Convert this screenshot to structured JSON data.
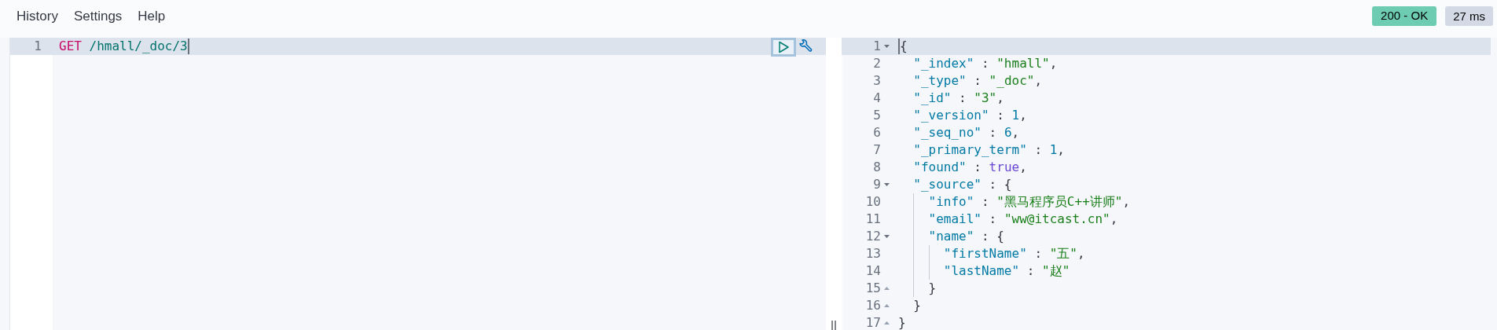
{
  "menu": [
    {
      "label": "History"
    },
    {
      "label": "Settings"
    },
    {
      "label": "Help"
    }
  ],
  "status": {
    "code": "200 - OK",
    "time": "27 ms"
  },
  "request": {
    "lines": [
      {
        "number": "1",
        "active": true,
        "tokens": [
          {
            "kind": "method",
            "text": "GET"
          },
          {
            "kind": "path",
            "text": "/hmall/_doc/3"
          },
          {
            "kind": "cursor"
          }
        ]
      }
    ]
  },
  "response": {
    "lines": [
      {
        "number": "1",
        "active": true,
        "kind": "open",
        "tokens": [
          {
            "kind": "cursor"
          },
          {
            "kind": "punct",
            "text": "{"
          }
        ]
      },
      {
        "number": "2",
        "active": false,
        "kind": "plain",
        "tokens": [
          {
            "kind": "key",
            "text": "  \"_index\""
          },
          {
            "kind": "punct",
            "text": " : "
          },
          {
            "kind": "string",
            "text": "\"hmall\""
          },
          {
            "kind": "punct",
            "text": ","
          }
        ]
      },
      {
        "number": "3",
        "active": false,
        "kind": "plain",
        "tokens": [
          {
            "kind": "key",
            "text": "  \"_type\""
          },
          {
            "kind": "punct",
            "text": " : "
          },
          {
            "kind": "string",
            "text": "\"_doc\""
          },
          {
            "kind": "punct",
            "text": ","
          }
        ]
      },
      {
        "number": "4",
        "active": false,
        "kind": "plain",
        "tokens": [
          {
            "kind": "key",
            "text": "  \"_id\""
          },
          {
            "kind": "punct",
            "text": " : "
          },
          {
            "kind": "string",
            "text": "\"3\""
          },
          {
            "kind": "punct",
            "text": ","
          }
        ]
      },
      {
        "number": "5",
        "active": false,
        "kind": "plain",
        "tokens": [
          {
            "kind": "key",
            "text": "  \"_version\""
          },
          {
            "kind": "punct",
            "text": " : "
          },
          {
            "kind": "number",
            "text": "1"
          },
          {
            "kind": "punct",
            "text": ","
          }
        ]
      },
      {
        "number": "6",
        "active": false,
        "kind": "plain",
        "tokens": [
          {
            "kind": "key",
            "text": "  \"_seq_no\""
          },
          {
            "kind": "punct",
            "text": " : "
          },
          {
            "kind": "number",
            "text": "6"
          },
          {
            "kind": "punct",
            "text": ","
          }
        ]
      },
      {
        "number": "7",
        "active": false,
        "kind": "plain",
        "tokens": [
          {
            "kind": "key",
            "text": "  \"_primary_term\""
          },
          {
            "kind": "punct",
            "text": " : "
          },
          {
            "kind": "number",
            "text": "1"
          },
          {
            "kind": "punct",
            "text": ","
          }
        ]
      },
      {
        "number": "8",
        "active": false,
        "kind": "plain",
        "tokens": [
          {
            "kind": "key",
            "text": "  \"found\""
          },
          {
            "kind": "punct",
            "text": " : "
          },
          {
            "kind": "boolean",
            "text": "true"
          },
          {
            "kind": "punct",
            "text": ","
          }
        ]
      },
      {
        "number": "9",
        "active": false,
        "kind": "open",
        "tokens": [
          {
            "kind": "key",
            "text": "  \"_source\""
          },
          {
            "kind": "punct",
            "text": " : {"
          }
        ]
      },
      {
        "number": "10",
        "active": false,
        "kind": "plain",
        "tokens": [
          {
            "kind": "key",
            "text": "    \"info\""
          },
          {
            "kind": "punct",
            "text": " : "
          },
          {
            "kind": "string",
            "text": "\"黑马程序员C++讲师\""
          },
          {
            "kind": "punct",
            "text": ","
          }
        ]
      },
      {
        "number": "11",
        "active": false,
        "kind": "plain",
        "tokens": [
          {
            "kind": "key",
            "text": "    \"email\""
          },
          {
            "kind": "punct",
            "text": " : "
          },
          {
            "kind": "string",
            "text": "\"ww@itcast.cn\""
          },
          {
            "kind": "punct",
            "text": ","
          }
        ]
      },
      {
        "number": "12",
        "active": false,
        "kind": "open",
        "tokens": [
          {
            "kind": "key",
            "text": "    \"name\""
          },
          {
            "kind": "punct",
            "text": " : {"
          }
        ]
      },
      {
        "number": "13",
        "active": false,
        "kind": "plain",
        "tokens": [
          {
            "kind": "key",
            "text": "      \"firstName\""
          },
          {
            "kind": "punct",
            "text": " : "
          },
          {
            "kind": "string",
            "text": "\"五\""
          },
          {
            "kind": "punct",
            "text": ","
          }
        ]
      },
      {
        "number": "14",
        "active": false,
        "kind": "plain",
        "tokens": [
          {
            "kind": "key",
            "text": "      \"lastName\""
          },
          {
            "kind": "punct",
            "text": " : "
          },
          {
            "kind": "string",
            "text": "\"赵\""
          }
        ]
      },
      {
        "number": "15",
        "active": false,
        "kind": "close",
        "tokens": [
          {
            "kind": "punct",
            "text": "    }"
          }
        ]
      },
      {
        "number": "16",
        "active": false,
        "kind": "close",
        "tokens": [
          {
            "kind": "punct",
            "text": "  }"
          }
        ]
      },
      {
        "number": "17",
        "active": false,
        "kind": "close",
        "tokens": [
          {
            "kind": "punct",
            "text": "}"
          }
        ]
      }
    ]
  }
}
